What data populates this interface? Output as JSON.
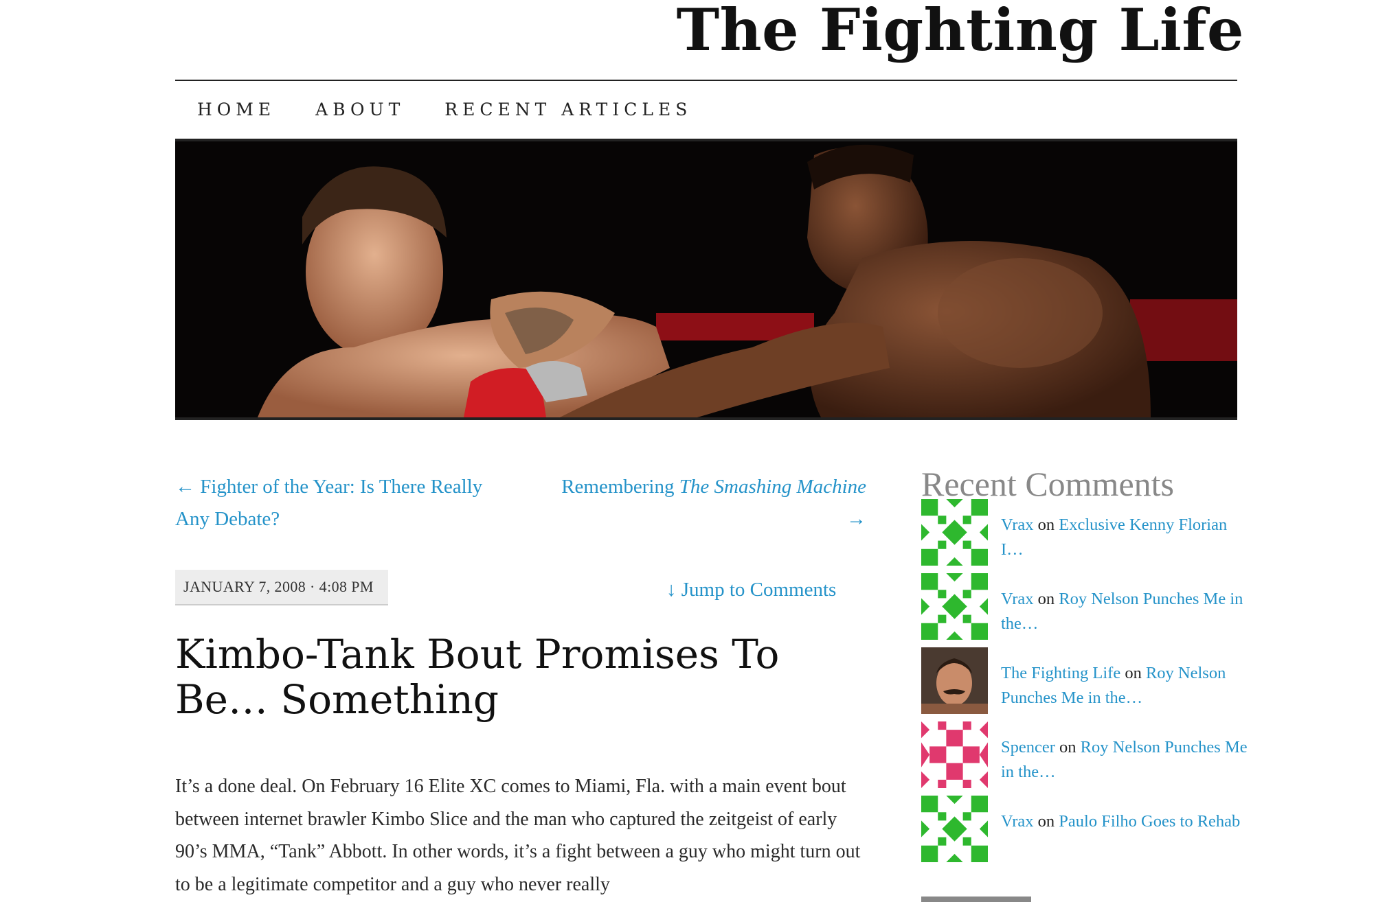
{
  "site": {
    "title": "The Fighting Life"
  },
  "nav": {
    "items": [
      "Home",
      "About",
      "Recent Articles"
    ]
  },
  "post_nav": {
    "prev": "← Fighter of the Year: Is There Really Any Debate?",
    "next_prefix": "Remembering ",
    "next_italic": "The Smashing Machine",
    "next_arrow": "→"
  },
  "post": {
    "date": "JANUARY 7, 2008 · 4:08 PM",
    "jump": "↓ Jump to Comments",
    "title": "Kimbo-Tank Bout Promises To Be… Something",
    "body": "It’s a done deal. On February 16 Elite XC comes to Miami, Fla. with a main event bout between internet brawler Kimbo Slice and the man who captured the zeitgeist of early 90’s MMA, “Tank” Abbott. In other words, it’s a fight between a guy who might turn out to be a legitimate competitor and a guy who never really"
  },
  "sidebar": {
    "heading": "Recent Comments",
    "comments": [
      {
        "author": "Vrax",
        "on": "on",
        "post": "Exclusive Kenny Florian I…",
        "avatar": "identicon-green"
      },
      {
        "author": "Vrax",
        "on": "on",
        "post": "Roy Nelson Punches Me in the…",
        "avatar": "identicon-green"
      },
      {
        "author": "The Fighting Life",
        "on": "on",
        "post": "Roy Nelson Punches Me in the…",
        "avatar": "photo-avatar"
      },
      {
        "author": "Spencer",
        "on": "on",
        "post": "Roy Nelson Punches Me in the…",
        "avatar": "identicon-pink"
      },
      {
        "author": "Vrax",
        "on": "on",
        "post": "Paulo Filho Goes to Rehab",
        "avatar": "identicon-green"
      }
    ]
  },
  "colors": {
    "link": "#2593c9",
    "identicon_green": "#2eb82e",
    "identicon_pink": "#e0396e"
  }
}
